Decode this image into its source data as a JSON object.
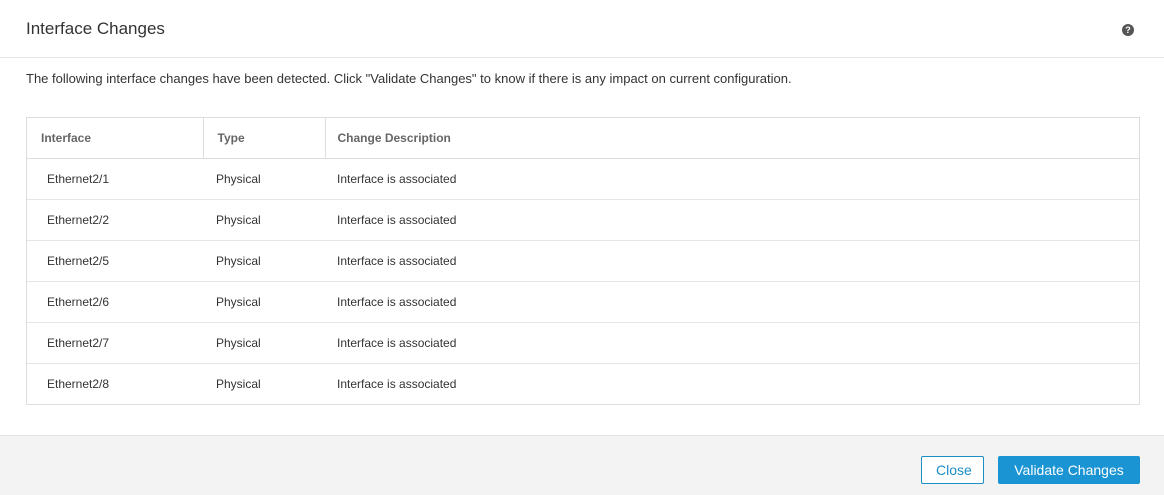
{
  "dialog": {
    "title": "Interface Changes",
    "help_icon": "help-circle-icon",
    "description": "The following interface changes have been detected. Click \"Validate Changes\" to know if there is any impact on current configuration."
  },
  "table": {
    "columns": [
      "Interface",
      "Type",
      "Change Description"
    ],
    "rows": [
      {
        "interface": "Ethernet2/1",
        "type": "Physical",
        "change": "Interface is associated"
      },
      {
        "interface": "Ethernet2/2",
        "type": "Physical",
        "change": "Interface is associated"
      },
      {
        "interface": "Ethernet2/5",
        "type": "Physical",
        "change": "Interface is associated"
      },
      {
        "interface": "Ethernet2/6",
        "type": "Physical",
        "change": "Interface is associated"
      },
      {
        "interface": "Ethernet2/7",
        "type": "Physical",
        "change": "Interface is associated"
      },
      {
        "interface": "Ethernet2/8",
        "type": "Physical",
        "change": "Interface is associated"
      }
    ]
  },
  "footer": {
    "close_label": "Close",
    "validate_label": "Validate Changes"
  },
  "colors": {
    "accent": "#1a94d2",
    "footer_bg": "#f3f3f3"
  }
}
